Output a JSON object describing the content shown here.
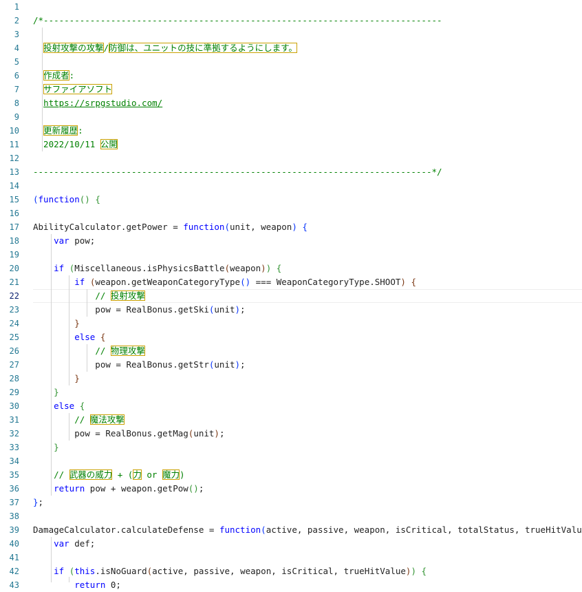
{
  "editor": {
    "language": "javascript",
    "highlighted_line": 22,
    "colors": {
      "line_number": "#237893",
      "comment": "#008000",
      "keyword": "#0000ff",
      "text": "#1f1f1f",
      "bracket_level_1": "#0431fa",
      "bracket_level_2": "#319331",
      "bracket_level_3": "#7b3814",
      "ambiguous_char_box": "#c9a100"
    }
  },
  "lines": [
    {
      "n": "1",
      "t": []
    },
    {
      "n": "2",
      "t": [
        {
          "c": "comment",
          "v": "/*-----------------------------------------------------------------------------"
        }
      ]
    },
    {
      "n": "3",
      "t": []
    },
    {
      "n": "4",
      "t": [
        {
          "c": "comment",
          "v": "  "
        },
        {
          "c": "comment",
          "v": "投射攻撃の攻撃",
          "h": 1
        },
        {
          "c": "comment",
          "v": "/"
        },
        {
          "c": "comment",
          "v": "防御は、ユニットの技に準拠するようにします。",
          "h": 1
        }
      ]
    },
    {
      "n": "5",
      "t": []
    },
    {
      "n": "6",
      "t": [
        {
          "c": "comment",
          "v": "  "
        },
        {
          "c": "comment",
          "v": "作成者",
          "h": 1
        },
        {
          "c": "comment",
          "v": ":"
        }
      ]
    },
    {
      "n": "7",
      "t": [
        {
          "c": "comment",
          "v": "  "
        },
        {
          "c": "comment",
          "v": "サファイアソフト",
          "h": 1
        }
      ]
    },
    {
      "n": "8",
      "t": [
        {
          "c": "comment",
          "v": "  "
        },
        {
          "c": "link",
          "v": "https://srpgstudio.com/"
        }
      ]
    },
    {
      "n": "9",
      "t": []
    },
    {
      "n": "10",
      "t": [
        {
          "c": "comment",
          "v": "  "
        },
        {
          "c": "comment",
          "v": "更新履歴",
          "h": 1
        },
        {
          "c": "comment",
          "v": ":"
        }
      ]
    },
    {
      "n": "11",
      "t": [
        {
          "c": "comment",
          "v": "  2022/10/11 "
        },
        {
          "c": "comment",
          "v": "公開",
          "h": 1
        }
      ]
    },
    {
      "n": "12",
      "t": []
    },
    {
      "n": "13",
      "t": [
        {
          "c": "comment",
          "v": "-----------------------------------------------------------------------------*/"
        }
      ]
    },
    {
      "n": "14",
      "t": []
    },
    {
      "n": "15",
      "t": [
        {
          "c": "bracket-a",
          "v": "("
        },
        {
          "c": "keyword",
          "v": "function"
        },
        {
          "c": "bracket-b",
          "v": "()"
        },
        {
          "c": "text",
          "v": " "
        },
        {
          "c": "bracket-b",
          "v": "{"
        }
      ]
    },
    {
      "n": "16",
      "t": []
    },
    {
      "n": "17",
      "t": [
        {
          "c": "text",
          "v": "AbilityCalculator.getPower = "
        },
        {
          "c": "keyword",
          "v": "function"
        },
        {
          "c": "bracket-a",
          "v": "("
        },
        {
          "c": "text",
          "v": "unit, weapon"
        },
        {
          "c": "bracket-a",
          "v": ")"
        },
        {
          "c": "text",
          "v": " "
        },
        {
          "c": "bracket-a",
          "v": "{"
        }
      ]
    },
    {
      "n": "18",
      "t": [
        {
          "c": "text",
          "v": "    "
        },
        {
          "c": "keyword",
          "v": "var"
        },
        {
          "c": "text",
          "v": " pow;"
        }
      ]
    },
    {
      "n": "19",
      "t": []
    },
    {
      "n": "20",
      "t": [
        {
          "c": "text",
          "v": "    "
        },
        {
          "c": "keyword",
          "v": "if"
        },
        {
          "c": "text",
          "v": " "
        },
        {
          "c": "bracket-b",
          "v": "("
        },
        {
          "c": "text",
          "v": "Miscellaneous.isPhysicsBattle"
        },
        {
          "c": "bracket-c",
          "v": "("
        },
        {
          "c": "text",
          "v": "weapon"
        },
        {
          "c": "bracket-c",
          "v": ")"
        },
        {
          "c": "bracket-b",
          "v": ")"
        },
        {
          "c": "text",
          "v": " "
        },
        {
          "c": "bracket-b",
          "v": "{"
        }
      ]
    },
    {
      "n": "21",
      "t": [
        {
          "c": "text",
          "v": "        "
        },
        {
          "c": "keyword",
          "v": "if"
        },
        {
          "c": "text",
          "v": " "
        },
        {
          "c": "bracket-c",
          "v": "("
        },
        {
          "c": "text",
          "v": "weapon.getWeaponCategoryType"
        },
        {
          "c": "bracket-a",
          "v": "()"
        },
        {
          "c": "text",
          "v": " === WeaponCategoryType.SHOOT"
        },
        {
          "c": "bracket-c",
          "v": ")"
        },
        {
          "c": "text",
          "v": " "
        },
        {
          "c": "bracket-c",
          "v": "{"
        }
      ]
    },
    {
      "n": "22",
      "t": [
        {
          "c": "text",
          "v": "            "
        },
        {
          "c": "comment",
          "v": "// "
        },
        {
          "c": "comment",
          "v": "投射攻撃",
          "h": 1
        }
      ]
    },
    {
      "n": "23",
      "t": [
        {
          "c": "text",
          "v": "            pow = RealBonus.getSki"
        },
        {
          "c": "bracket-a",
          "v": "("
        },
        {
          "c": "text",
          "v": "unit"
        },
        {
          "c": "bracket-a",
          "v": ")"
        },
        {
          "c": "text",
          "v": ";"
        }
      ]
    },
    {
      "n": "24",
      "t": [
        {
          "c": "text",
          "v": "        "
        },
        {
          "c": "bracket-c",
          "v": "}"
        }
      ]
    },
    {
      "n": "25",
      "t": [
        {
          "c": "text",
          "v": "        "
        },
        {
          "c": "keyword",
          "v": "else"
        },
        {
          "c": "text",
          "v": " "
        },
        {
          "c": "bracket-c",
          "v": "{"
        }
      ]
    },
    {
      "n": "26",
      "t": [
        {
          "c": "text",
          "v": "            "
        },
        {
          "c": "comment",
          "v": "// "
        },
        {
          "c": "comment",
          "v": "物理攻撃",
          "h": 1
        }
      ]
    },
    {
      "n": "27",
      "t": [
        {
          "c": "text",
          "v": "            pow = RealBonus.getStr"
        },
        {
          "c": "bracket-a",
          "v": "("
        },
        {
          "c": "text",
          "v": "unit"
        },
        {
          "c": "bracket-a",
          "v": ")"
        },
        {
          "c": "text",
          "v": ";"
        }
      ]
    },
    {
      "n": "28",
      "t": [
        {
          "c": "text",
          "v": "        "
        },
        {
          "c": "bracket-c",
          "v": "}"
        }
      ]
    },
    {
      "n": "29",
      "t": [
        {
          "c": "text",
          "v": "    "
        },
        {
          "c": "bracket-b",
          "v": "}"
        }
      ]
    },
    {
      "n": "30",
      "t": [
        {
          "c": "text",
          "v": "    "
        },
        {
          "c": "keyword",
          "v": "else"
        },
        {
          "c": "text",
          "v": " "
        },
        {
          "c": "bracket-b",
          "v": "{"
        }
      ]
    },
    {
      "n": "31",
      "t": [
        {
          "c": "text",
          "v": "        "
        },
        {
          "c": "comment",
          "v": "// "
        },
        {
          "c": "comment",
          "v": "魔法攻撃",
          "h": 1
        }
      ]
    },
    {
      "n": "32",
      "t": [
        {
          "c": "text",
          "v": "        pow = RealBonus.getMag"
        },
        {
          "c": "bracket-c",
          "v": "("
        },
        {
          "c": "text",
          "v": "unit"
        },
        {
          "c": "bracket-c",
          "v": ")"
        },
        {
          "c": "text",
          "v": ";"
        }
      ]
    },
    {
      "n": "33",
      "t": [
        {
          "c": "text",
          "v": "    "
        },
        {
          "c": "bracket-b",
          "v": "}"
        }
      ]
    },
    {
      "n": "34",
      "t": []
    },
    {
      "n": "35",
      "t": [
        {
          "c": "text",
          "v": "    "
        },
        {
          "c": "comment",
          "v": "// "
        },
        {
          "c": "comment",
          "v": "武器の威力",
          "h": 1
        },
        {
          "c": "comment",
          "v": " + ("
        },
        {
          "c": "comment",
          "v": "力",
          "h": 1
        },
        {
          "c": "comment",
          "v": " or "
        },
        {
          "c": "comment",
          "v": "魔力",
          "h": 1
        },
        {
          "c": "comment",
          "v": ")"
        }
      ]
    },
    {
      "n": "36",
      "t": [
        {
          "c": "text",
          "v": "    "
        },
        {
          "c": "keyword",
          "v": "return"
        },
        {
          "c": "text",
          "v": " pow + weapon.getPow"
        },
        {
          "c": "bracket-b",
          "v": "()"
        },
        {
          "c": "text",
          "v": ";"
        }
      ]
    },
    {
      "n": "37",
      "t": [
        {
          "c": "bracket-a",
          "v": "}"
        },
        {
          "c": "text",
          "v": ";"
        }
      ]
    },
    {
      "n": "38",
      "t": []
    },
    {
      "n": "39",
      "t": [
        {
          "c": "text",
          "v": "DamageCalculator.calculateDefense = "
        },
        {
          "c": "keyword",
          "v": "function"
        },
        {
          "c": "bracket-a",
          "v": "("
        },
        {
          "c": "text",
          "v": "active, passive, weapon, isCritical, totalStatus, trueHitValue"
        },
        {
          "c": "bracket-a",
          "v": ")"
        },
        {
          "c": "text",
          "v": " "
        },
        {
          "c": "bracket-a",
          "v": "{"
        }
      ]
    },
    {
      "n": "40",
      "t": [
        {
          "c": "text",
          "v": "    "
        },
        {
          "c": "keyword",
          "v": "var"
        },
        {
          "c": "text",
          "v": " def;"
        }
      ]
    },
    {
      "n": "41",
      "t": []
    },
    {
      "n": "42",
      "t": [
        {
          "c": "text",
          "v": "    "
        },
        {
          "c": "keyword",
          "v": "if"
        },
        {
          "c": "text",
          "v": " "
        },
        {
          "c": "bracket-b",
          "v": "("
        },
        {
          "c": "keyword",
          "v": "this"
        },
        {
          "c": "text",
          "v": ".isNoGuard"
        },
        {
          "c": "bracket-c",
          "v": "("
        },
        {
          "c": "text",
          "v": "active, passive, weapon, isCritical, trueHitValue"
        },
        {
          "c": "bracket-c",
          "v": ")"
        },
        {
          "c": "bracket-b",
          "v": ")"
        },
        {
          "c": "text",
          "v": " "
        },
        {
          "c": "bracket-b",
          "v": "{"
        }
      ]
    },
    {
      "n": "43",
      "t": [
        {
          "c": "text",
          "v": "        "
        },
        {
          "c": "keyword",
          "v": "return"
        },
        {
          "c": "text",
          "v": " 0;"
        }
      ]
    }
  ]
}
